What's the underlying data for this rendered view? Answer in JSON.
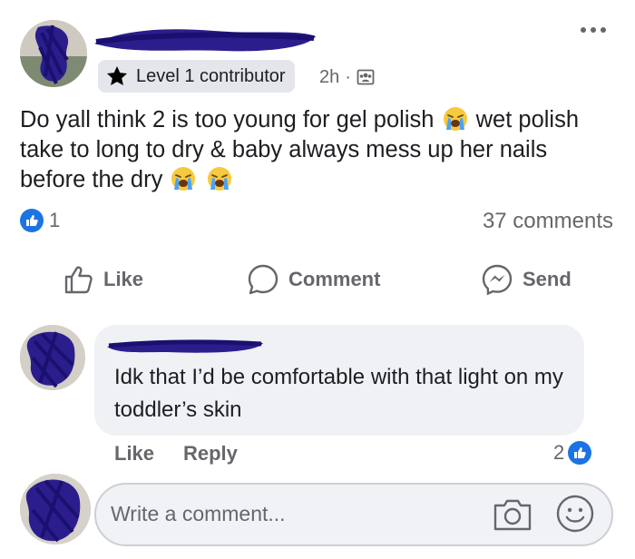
{
  "post": {
    "badge_label": "Level 1 contributor",
    "time": "2h",
    "separator": "·",
    "text_part1": "Do yall think 2 is too young for gel polish",
    "text_part2": " wet polish take to long to dry & baby always mess up her nails before the dry",
    "emoji_name": "loudly-crying-face",
    "reaction_count": "1",
    "comments_label": "37 comments"
  },
  "actions": {
    "like": "Like",
    "comment": "Comment",
    "send": "Send"
  },
  "comment": {
    "text": "Idk that I’d be comfortable with that light on my toddler’s skin",
    "like_label": "Like",
    "reply_label": "Reply",
    "reaction_count": "2"
  },
  "composer": {
    "placeholder": "Write a comment..."
  },
  "colors": {
    "accent": "#1b74e4",
    "scribble": "#2b1e8c",
    "secondary_text": "#65676b"
  }
}
